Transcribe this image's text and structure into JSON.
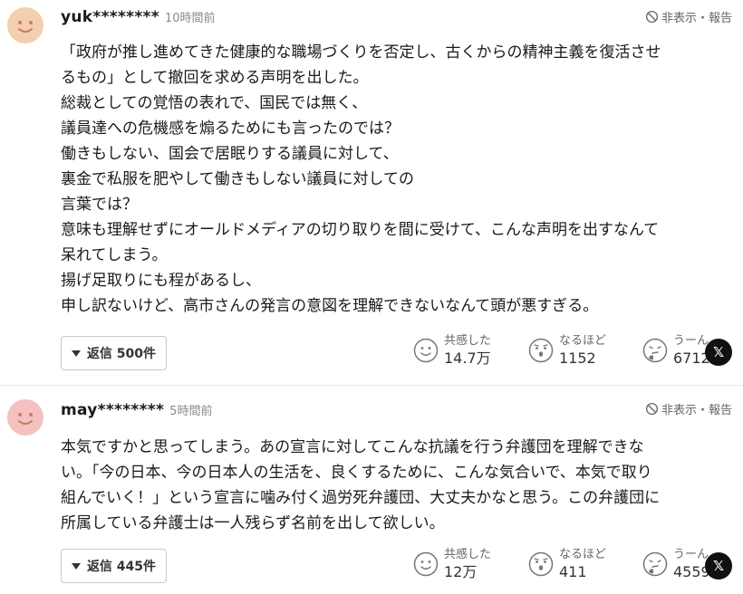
{
  "labels": {
    "hide_report": "非表示・報告",
    "empathy": "共感した",
    "insight": "なるほど",
    "hmm": "うーん",
    "x_share": "𝕏"
  },
  "colors": {
    "avatar_1": "#f3cfae",
    "avatar_2": "#f5c0c0",
    "face_features": "#c97b63"
  },
  "comments": [
    {
      "username": "yuk********",
      "timestamp": "10時間前",
      "lines": [
        "「政府が推し進めてきた健康的な職場づくりを否定し、古くからの精神主義を復活させ",
        "るもの」として撤回を求める声明を出した。",
        "総裁としての覚悟の表れで、国民では無く、",
        "議員達への危機感を煽るためにも言ったのでは？",
        "働きもしない、国会で居眠りする議員に対して、",
        "裏金で私服を肥やして働きもしない議員に対しての",
        "言葉では？",
        "意味も理解せずにオールドメディアの切り取りを間に受けて、こんな声明を出すなんて",
        "呆れてしまう。",
        "揚げ足取りにも程があるし、",
        "申し訳ないけど、高市さんの発言の意図を理解できないなんて頭が悪すぎる。"
      ],
      "reply_label": "返信 500件",
      "empathy_count": "14.7万",
      "insight_count": "1152",
      "hmm_count": "6712"
    },
    {
      "username": "may********",
      "timestamp": "5時間前",
      "lines": [
        "本気ですかと思ってしまう。あの宣言に対してこんな抗議を行う弁護団を理解できな",
        "い。「今の日本、今の日本人の生活を、良くするために、こんな気合いで、本気で取り",
        "組んでいく！」という宣言に噛み付く過労死弁護団、大丈夫かなと思う。この弁護団に",
        "所属している弁護士は一人残らず名前を出して欲しい。"
      ],
      "reply_label": "返信 445件",
      "empathy_count": "12万",
      "insight_count": "411",
      "hmm_count": "4559"
    }
  ]
}
